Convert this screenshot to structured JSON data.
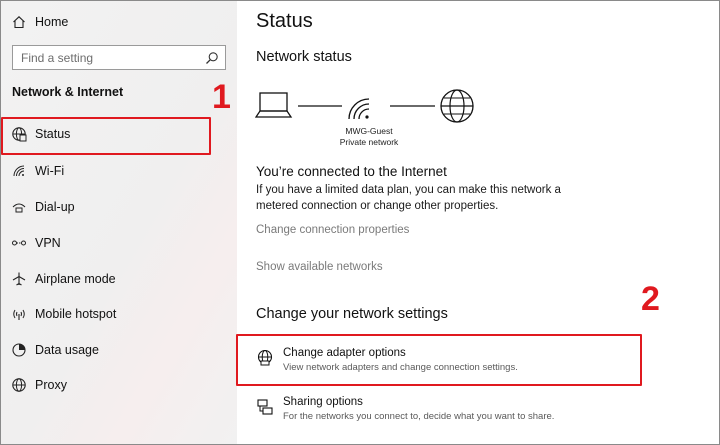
{
  "sidebar": {
    "home_label": "Home",
    "search_placeholder": "Find a setting",
    "section_title": "Network & Internet",
    "items": [
      {
        "label": "Status",
        "icon": "globe-network-icon"
      },
      {
        "label": "Wi-Fi",
        "icon": "wifi-icon"
      },
      {
        "label": "Dial-up",
        "icon": "dialup-icon"
      },
      {
        "label": "VPN",
        "icon": "vpn-icon"
      },
      {
        "label": "Airplane mode",
        "icon": "airplane-icon"
      },
      {
        "label": "Mobile hotspot",
        "icon": "hotspot-icon"
      },
      {
        "label": "Data usage",
        "icon": "data-usage-icon"
      },
      {
        "label": "Proxy",
        "icon": "globe-icon"
      }
    ]
  },
  "annotations": {
    "step1": "1",
    "step2": "2",
    "color": "#e0191f"
  },
  "main": {
    "title": "Status",
    "network_status_heading": "Network status",
    "network_name": "MWG-Guest",
    "network_type": "Private network",
    "connected_heading": "You’re connected to the Internet",
    "connected_desc": "If you have a limited data plan, you can make this network a metered connection or change other properties.",
    "change_connection_link": "Change connection properties",
    "show_networks_link": "Show available networks",
    "change_settings_heading": "Change your network settings",
    "options": [
      {
        "title": "Change adapter options",
        "desc": "View network adapters and change connection settings.",
        "icon": "adapter-globe-icon"
      },
      {
        "title": "Sharing options",
        "desc": "For the networks you connect to, decide what you want to share.",
        "icon": "sharing-icon"
      }
    ]
  }
}
